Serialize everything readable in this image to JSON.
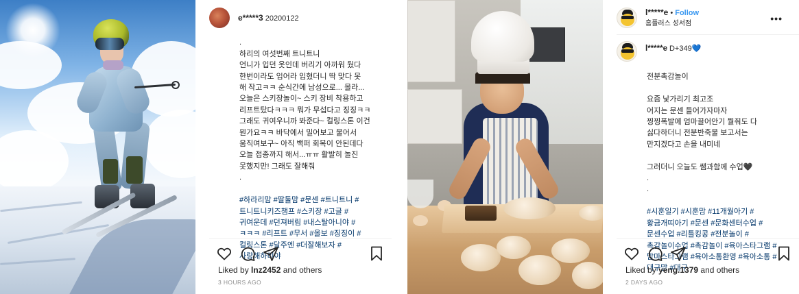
{
  "posts": [
    {
      "username": "e*****3",
      "date": "20200122",
      "caption": ".\n하리의 여섯번째 트니트니\n언니가 입던 옷인데 버리기 아까워 뒀다\n한번이라도 입어라 입혔더니 딱 맞다 못\n해 작고ㅋㅋ 순식간에 남성으로... 몰라...\n오늘은 스키장놀이~ 스키 장비 착용하고\n리프트탔다ㅋㅋㅋ 뭐가 무섭다고 징징ㅋㅋ\n그래도 귀여우니까 봐준다~ 컬링스톤 이건\n뭔가요ㅋㅋ 바닥에서 밀어보고 물어서\n움직여보구~ 아직 백퍼 회복이 안된데다\n오늘 접종까지 해서...ㅠㅠ 활발히 놀진\n못했지만! 그래도 잘해줘\n.",
      "hashtags": "#하라리맘 #딸둘맘 #문센 #트니트니 #\n트니트니키즈챔프 #스키장 #고글 #\n귀여운데 #던져버림 #내스탈아니야 #\nㅋㅋㅋ #리프트 #무서 #올보 #징징이 #\n컬링스톤 #달주엔 #더잘해보자 #\n사랑해하리야",
      "liked_by_prefix": "Liked by ",
      "liked_by_user": "lnz2452",
      "liked_by_suffix": " and others",
      "time_ago": "3 HOURS AGO"
    },
    {
      "username": "l*****e",
      "follow_label": "Follow",
      "location": "홈플러스 성서점",
      "comment_user": "l*****e",
      "comment_time": "D+349",
      "comment_heart": "💙",
      "caption": "전분촉감놀이\n\n요즘 낯가리기 최고조\n어지는 문센 들어가자마자\n찡찡폭발에 엄마끌어안기 뭘줘도 다\n싫다하더니 전분반죽물 보고서는\n만지겠다고 손을 내미네\n\n그러더니 오늘도 쌤과함께 수업🖤\n.\n.",
      "hashtags": "#시훈일기 #시훈맘 #11개월아기 #\n황금개띠아기 #문센 #문화센터수업 #\n문센수업 #리틀킹콩 #전분놀이 #\n촉감놀이수업 #촉감놀이 #육아스타그램 #\n맘마스타그램 #육아소통환영 #육아소통 #\n대구맘 #대구",
      "liked_by_prefix": "Liked by ",
      "liked_by_user": "yeng.1379",
      "liked_by_suffix": " and others",
      "time_ago": "2 DAYS AGO"
    }
  ],
  "icons": {
    "like": "heart-icon",
    "comment": "comment-icon",
    "share": "paper-plane-icon",
    "save": "bookmark-icon",
    "more": "more-options-icon"
  },
  "colors": {
    "hashtag": "#003569",
    "follow": "#3897f0",
    "meta": "#8e8e8e"
  },
  "ui": {
    "more_glyph": "•••",
    "dot": "•"
  }
}
